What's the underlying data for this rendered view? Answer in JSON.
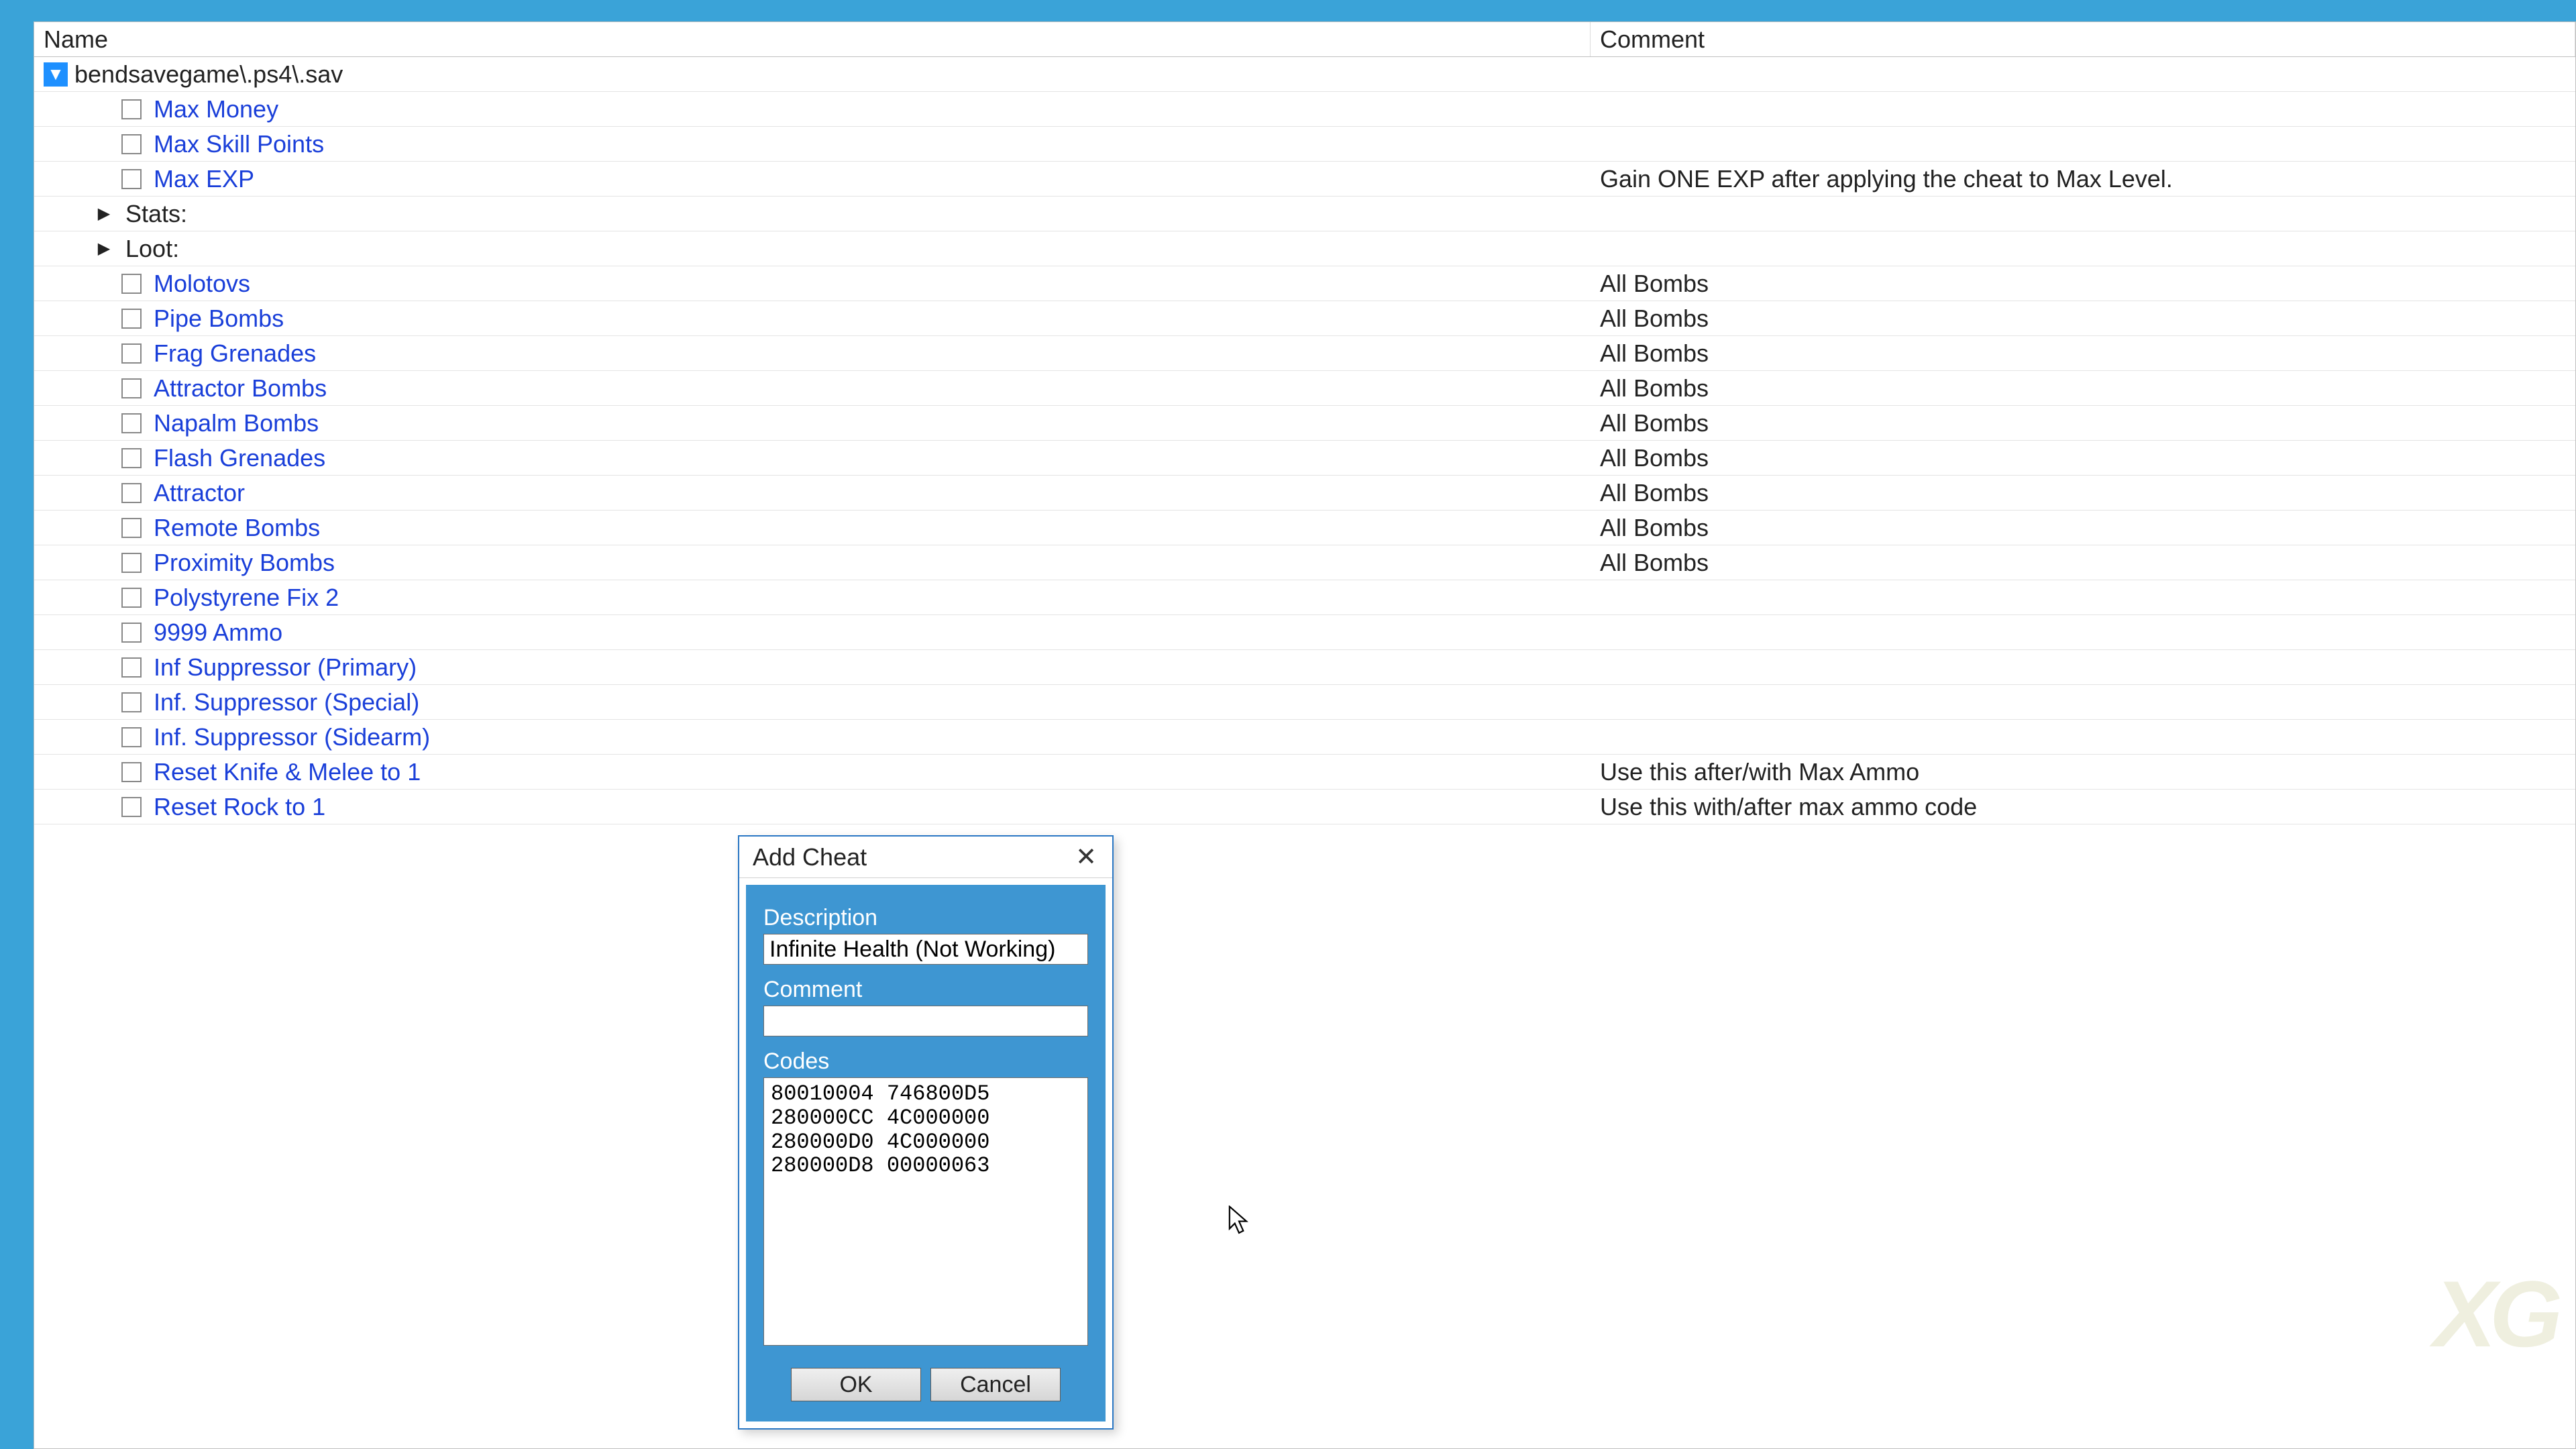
{
  "table": {
    "headers": {
      "name": "Name",
      "comment": "Comment"
    },
    "root": {
      "label": "bendsavegame\\.ps4\\.sav"
    },
    "rows": [
      {
        "type": "item",
        "label": "Max Money",
        "comment": "",
        "link": true
      },
      {
        "type": "item",
        "label": "Max Skill Points",
        "comment": "",
        "link": true
      },
      {
        "type": "item",
        "label": "Max EXP",
        "comment": "Gain ONE EXP after applying the cheat to Max Level.",
        "link": true
      },
      {
        "type": "group",
        "label": "Stats:",
        "comment": ""
      },
      {
        "type": "group",
        "label": "Loot:",
        "comment": ""
      },
      {
        "type": "item",
        "label": "Molotovs",
        "comment": "All Bombs",
        "link": true
      },
      {
        "type": "item",
        "label": "Pipe Bombs",
        "comment": "All Bombs",
        "link": true
      },
      {
        "type": "item",
        "label": "Frag Grenades",
        "comment": "All Bombs",
        "link": true
      },
      {
        "type": "item",
        "label": "Attractor Bombs",
        "comment": "All Bombs",
        "link": true
      },
      {
        "type": "item",
        "label": "Napalm Bombs",
        "comment": "All Bombs",
        "link": true
      },
      {
        "type": "item",
        "label": "Flash Grenades",
        "comment": "All Bombs",
        "link": true
      },
      {
        "type": "item",
        "label": "Attractor",
        "comment": "All Bombs",
        "link": true
      },
      {
        "type": "item",
        "label": "Remote Bombs",
        "comment": "All Bombs",
        "link": true
      },
      {
        "type": "item",
        "label": "Proximity Bombs",
        "comment": "All Bombs",
        "link": true
      },
      {
        "type": "item",
        "label": "Polystyrene Fix 2",
        "comment": "",
        "link": true
      },
      {
        "type": "item",
        "label": "9999 Ammo",
        "comment": "",
        "link": true
      },
      {
        "type": "item",
        "label": "Inf Suppressor (Primary)",
        "comment": "",
        "link": true
      },
      {
        "type": "item",
        "label": "Inf. Suppressor (Special)",
        "comment": "",
        "link": true
      },
      {
        "type": "item",
        "label": "Inf. Suppressor (Sidearm)",
        "comment": "",
        "link": true
      },
      {
        "type": "item",
        "label": "Reset Knife & Melee to 1",
        "comment": "Use this after/with Max Ammo",
        "link": true
      },
      {
        "type": "item",
        "label": "Reset Rock to 1",
        "comment": "Use this with/after max ammo code",
        "link": true
      }
    ]
  },
  "dialog": {
    "title": "Add Cheat",
    "labels": {
      "description": "Description",
      "comment": "Comment",
      "codes": "Codes"
    },
    "values": {
      "description": "Infinite Health (Not Working)",
      "comment": "",
      "codes": "80010004 746800D5\n280000CC 4C000000\n280000D0 4C000000\n280000D8 00000063"
    },
    "buttons": {
      "ok": "OK",
      "cancel": "Cancel"
    }
  },
  "watermark": "XG"
}
